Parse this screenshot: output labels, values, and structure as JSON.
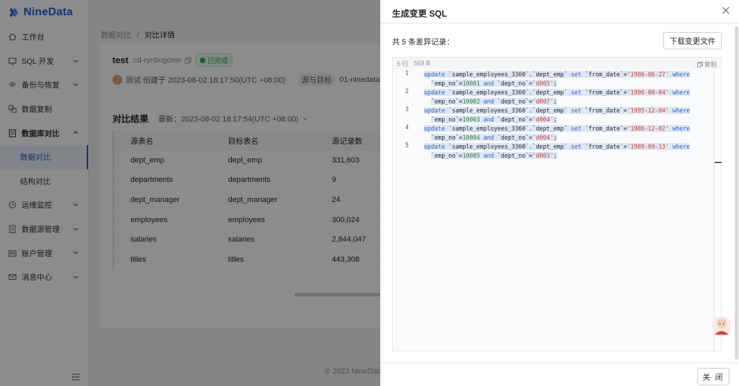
{
  "app": {
    "name": "NineData",
    "brand_color": "#1d5fd8"
  },
  "sidebar": {
    "items": [
      {
        "label": "工作台",
        "icon": "home-icon",
        "has_children": false
      },
      {
        "label": "SQL 开发",
        "icon": "sql-icon",
        "has_children": true
      },
      {
        "label": "备份与恢复",
        "icon": "backup-icon",
        "has_children": true
      },
      {
        "label": "数据复制",
        "icon": "replication-icon",
        "has_children": false
      },
      {
        "label": "数据库对比",
        "icon": "compare-icon",
        "has_children": true,
        "expanded": true,
        "children": [
          {
            "label": "数据对比",
            "active": true
          },
          {
            "label": "结构对比",
            "active": false
          }
        ]
      },
      {
        "label": "运维监控",
        "icon": "monitor-icon",
        "has_children": true
      },
      {
        "label": "数据源管理",
        "icon": "datasource-icon",
        "has_children": true
      },
      {
        "label": "账户管理",
        "icon": "account-icon",
        "has_children": true
      },
      {
        "label": "消息中心",
        "icon": "mail-icon",
        "has_children": true
      }
    ]
  },
  "breadcrumb": {
    "parent": "数据对比",
    "separator": "/",
    "current": "对比详情"
  },
  "task": {
    "name": "test",
    "id": "cd-ryrdxqjcmv",
    "status": "已完成",
    "creator_line": "测试 创建于 2023-08-02 18:17:50(UTC +08:00)",
    "source_target_label": "源与目标",
    "target_prefix": "01-ninedata"
  },
  "result": {
    "title": "对比结果",
    "latest": "最新：2023-08-02 18:17:54(UTC +08:00)",
    "columns": [
      "源表名",
      "目标表名",
      "源记录数"
    ],
    "rows": [
      [
        "dept_emp",
        "dept_emp",
        "331,603"
      ],
      [
        "departments",
        "departments",
        "9"
      ],
      [
        "dept_manager",
        "dept_manager",
        "24"
      ],
      [
        "employees",
        "employees",
        "300,024"
      ],
      [
        "salaries",
        "salaries",
        "2,844,047"
      ],
      [
        "titles",
        "titles",
        "443,308"
      ]
    ]
  },
  "footer": {
    "copyright": "© 2023 NineData"
  },
  "drawer": {
    "title": "生成变更 SQL",
    "diff_count": "共 5 条差异记录：",
    "download_label": "下载变更文件",
    "code_meta": {
      "lines": "5 行",
      "size": "569 B",
      "copy_label": "复制"
    },
    "sql": [
      {
        "no": "1",
        "from_date": "1986-06-27",
        "emp_no": "10001",
        "dept_no": "d005"
      },
      {
        "no": "2",
        "from_date": "1996-08-04",
        "emp_no": "10002",
        "dept_no": "d007"
      },
      {
        "no": "3",
        "from_date": "1995-12-04",
        "emp_no": "10003",
        "dept_no": "d004"
      },
      {
        "no": "4",
        "from_date": "1986-12-02",
        "emp_no": "10004",
        "dept_no": "d004"
      },
      {
        "no": "5",
        "from_date": "1989-09-13",
        "emp_no": "10005",
        "dept_no": "d003"
      }
    ],
    "close_label": "关 闭"
  }
}
